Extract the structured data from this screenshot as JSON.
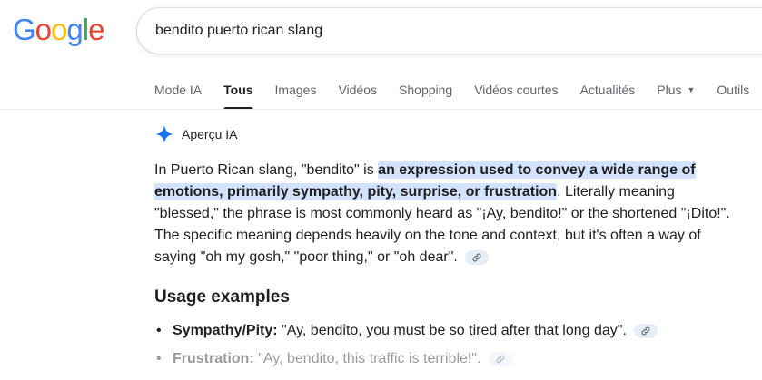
{
  "logo": {
    "letters": [
      "G",
      "o",
      "o",
      "g",
      "l",
      "e"
    ],
    "colors": [
      "#4285F4",
      "#EA4335",
      "#FBBC05",
      "#4285F4",
      "#34A853",
      "#EA4335"
    ]
  },
  "search": {
    "query": "bendito puerto rican slang"
  },
  "tabs": [
    {
      "label": "Mode IA"
    },
    {
      "label": "Tous",
      "active": true
    },
    {
      "label": "Images"
    },
    {
      "label": "Vidéos"
    },
    {
      "label": "Shopping"
    },
    {
      "label": "Vidéos courtes"
    },
    {
      "label": "Actualités"
    },
    {
      "label": "Plus",
      "caret": "▼"
    },
    {
      "label": "Outils"
    }
  ],
  "ai_overview": {
    "label": "Aperçu IA",
    "sparkle_color": "#1a73e8",
    "para_prefix": "In Puerto Rican slang, \"bendito\" is ",
    "para_highlight": "an expression used to convey a wide range of emotions, primarily sympathy, pity, surprise, or frustration",
    "para_suffix": ". Literally meaning \"blessed,\" the phrase is most commonly heard as \"¡Ay, bendito!\" or the shortened \"¡Dito!\". The specific meaning depends heavily on the tone and context, but it's often a way of saying \"oh my gosh,\" \"poor thing,\" or \"oh dear\".",
    "section_title": "Usage examples",
    "examples": [
      {
        "term": "Sympathy/Pity:",
        "text": " \"Ay, bendito, you must be so tired after that long day\"."
      },
      {
        "term": "Frustration:",
        "text": " \"Ay, bendito, this traffic is terrible!\"."
      }
    ]
  }
}
